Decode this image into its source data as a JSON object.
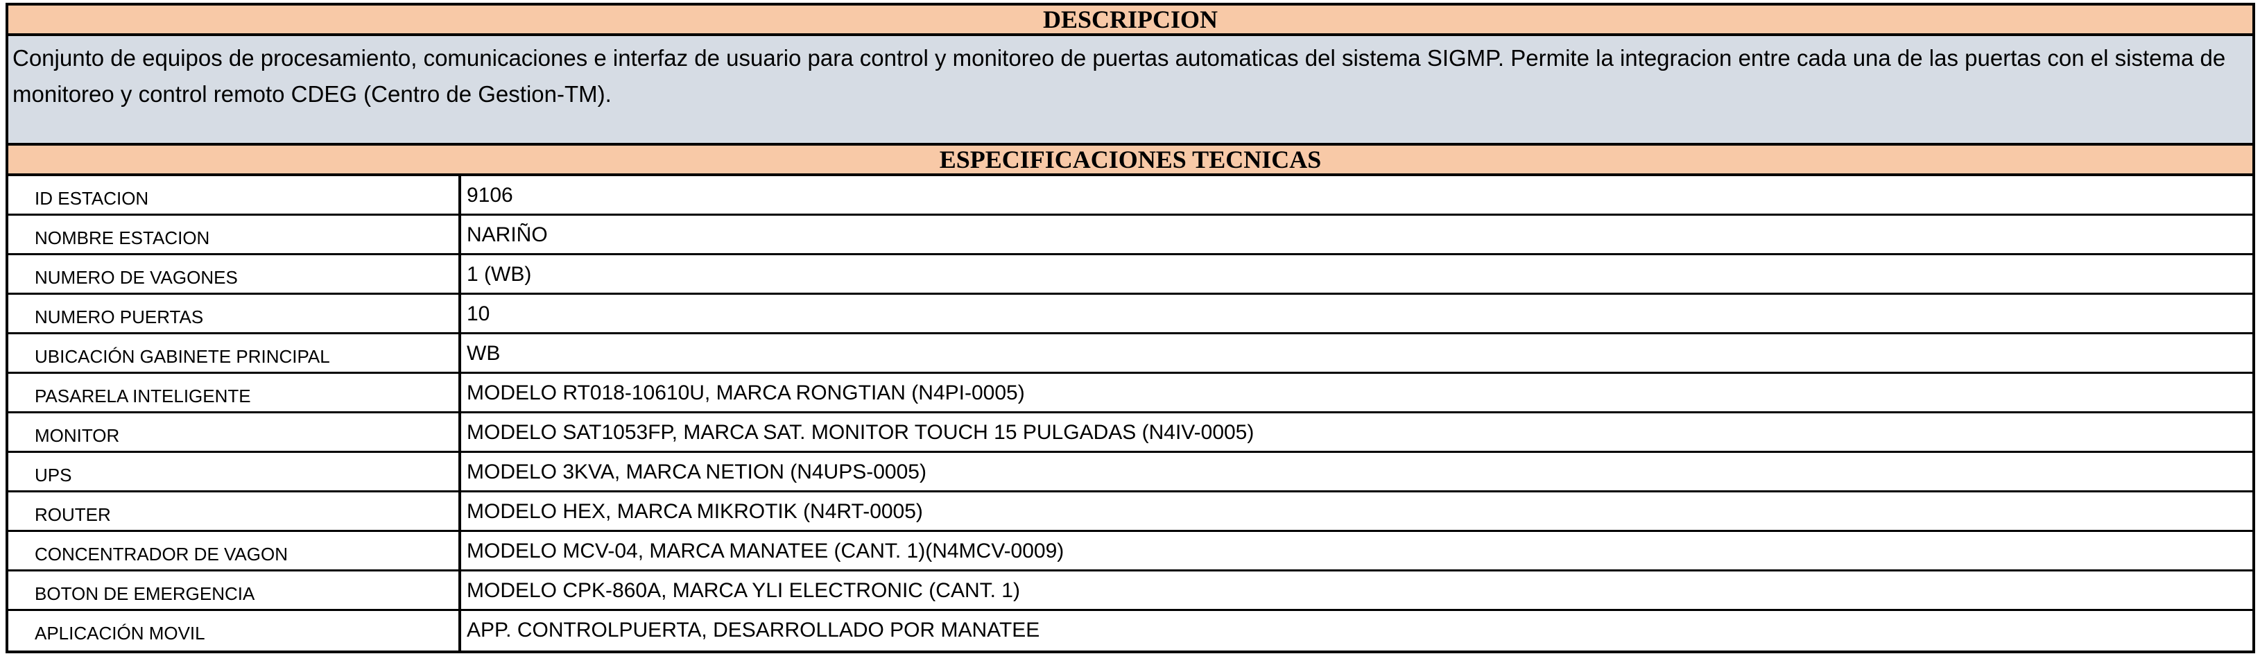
{
  "description": {
    "header": "DESCRIPCION",
    "text": "Conjunto de equipos de procesamiento, comunicaciones e interfaz de usuario para control y monitoreo de puertas automaticas del sistema SIGMP. Permite la integracion entre cada una de las puertas con el sistema de monitoreo y control remoto CDEG (Centro de Gestion-TM)."
  },
  "specs": {
    "header": "ESPECIFICACIONES TECNICAS",
    "rows": [
      {
        "label": "ID ESTACION",
        "value": "9106"
      },
      {
        "label": "NOMBRE ESTACION",
        "value": "NARIÑO"
      },
      {
        "label": "NUMERO DE VAGONES",
        "value": "1 (WB)"
      },
      {
        "label": "NUMERO PUERTAS",
        "value": "10"
      },
      {
        "label": "UBICACIÓN GABINETE PRINCIPAL",
        "value": "WB"
      },
      {
        "label": "PASARELA INTELIGENTE",
        "value": "MODELO RT018-10610U, MARCA RONGTIAN (N4PI-0005)"
      },
      {
        "label": "MONITOR",
        "value": "MODELO SAT1053FP, MARCA SAT. MONITOR TOUCH 15 PULGADAS (N4IV-0005)"
      },
      {
        "label": "UPS",
        "value": "MODELO 3KVA, MARCA NETION (N4UPS-0005)"
      },
      {
        "label": "ROUTER",
        "value": "MODELO HEX, MARCA MIKROTIK (N4RT-0005)"
      },
      {
        "label": "CONCENTRADOR DE VAGON",
        "value": "MODELO MCV-04, MARCA MANATEE (CANT. 1)(N4MCV-0009)"
      },
      {
        "label": "BOTON DE EMERGENCIA",
        "value": "MODELO CPK-860A, MARCA YLI ELECTRONIC (CANT. 1)"
      },
      {
        "label": "APLICACIÓN MOVIL",
        "value": "APP. CONTROLPUERTA, DESARROLLADO POR MANATEE"
      }
    ]
  },
  "colors": {
    "header_bg": "#f8c9a7",
    "description_bg": "#d6dce4",
    "border": "#000000"
  }
}
